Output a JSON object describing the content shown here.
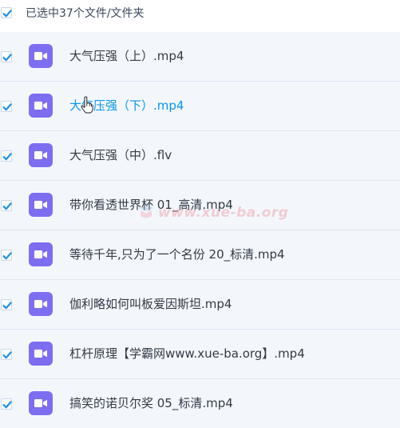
{
  "header": {
    "selection_text": "已选中37个文件/文件夹",
    "checked": true
  },
  "files": [
    {
      "name": "大气压强（上）.mp4",
      "icon": "video-file-icon",
      "checked": true
    },
    {
      "name": "大气压强（下）.mp4",
      "icon": "video-file-icon",
      "checked": true
    },
    {
      "name": "大气压强（中）.flv",
      "icon": "video-file-icon",
      "checked": true
    },
    {
      "name": "带你看透世界杯 01_高清.mp4",
      "icon": "video-file-icon",
      "checked": true
    },
    {
      "name": "等待千年,只为了一个名份 20_标清.mp4",
      "icon": "video-file-icon",
      "checked": true
    },
    {
      "name": "伽利略如何叫板爱因斯坦.mp4",
      "icon": "video-file-icon",
      "checked": true
    },
    {
      "name": "杠杆原理【学霸网www.xue-ba.org】.mp4",
      "icon": "video-file-icon",
      "checked": true
    },
    {
      "name": "搞笑的诺贝尔奖 05_标清.mp4",
      "icon": "video-file-icon",
      "checked": true
    }
  ],
  "watermark": {
    "text": "www.xue-ba.org"
  },
  "colors": {
    "accent": "#0996e3",
    "icon_bg": "#7d6ef0",
    "row_bg": "#f3f7fc",
    "checkmark": "#1e8fe1"
  }
}
